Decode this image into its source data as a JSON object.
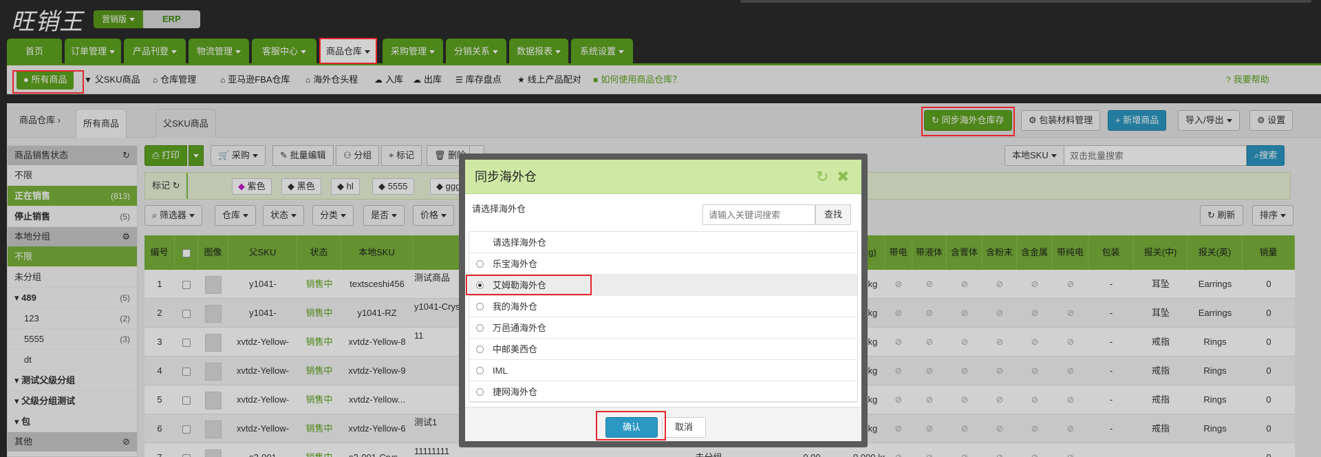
{
  "brand": {
    "logo": "旺销王",
    "edition": "营销版",
    "product": "ERP"
  },
  "main_nav": [
    {
      "label": "首页",
      "dropdown": false
    },
    {
      "label": "订单管理",
      "dropdown": true
    },
    {
      "label": "产品刊登",
      "dropdown": true
    },
    {
      "label": "物流管理",
      "dropdown": true
    },
    {
      "label": "客服中心",
      "dropdown": true
    },
    {
      "label": "商品仓库",
      "dropdown": true,
      "active": true
    },
    {
      "label": "采购管理",
      "dropdown": true
    },
    {
      "label": "分销关系",
      "dropdown": true
    },
    {
      "label": "数据报表",
      "dropdown": true
    },
    {
      "label": "系统设置",
      "dropdown": true
    }
  ],
  "sub_nav": {
    "all_products": "所有商品",
    "items": [
      "父SKU商品",
      "仓库管理",
      "亚马逊FBA仓库",
      "海外仓头程",
      "入库",
      "出库",
      "库存盘点",
      "线上产品配对"
    ],
    "how_to": "如何使用商品仓库？",
    "help": "我要帮助"
  },
  "breadcrumb": {
    "root": "商品仓库",
    "sep": "›",
    "tabs": [
      "所有商品",
      "父SKU商品"
    ]
  },
  "header_buttons": {
    "sync": "同步海外仓库存",
    "packaging": "包装材料管理",
    "add": "新增商品",
    "import_export": "导入/导出",
    "settings": "设置"
  },
  "toolbar": {
    "print": "打印",
    "purchase": "采购",
    "batch_edit": "批量编辑",
    "group": "分组",
    "mark": "标记",
    "delete": "删除"
  },
  "search": {
    "scope": "本地SKU",
    "placeholder": "双击批量搜索",
    "button": "搜索"
  },
  "mark_bar": {
    "label": "标记",
    "tags": [
      "紫色",
      "黑色",
      "hl",
      "5555",
      "ggg"
    ]
  },
  "filters": {
    "filter": "筛选器",
    "warehouse": "仓库",
    "status": "状态",
    "category": "分类",
    "yes_no": "是否",
    "price": "价格",
    "refresh": "刷新",
    "sort": "排序"
  },
  "sidebar": {
    "sales_status_title": "商品销售状态",
    "sales_status": [
      {
        "label": "不限",
        "count": ""
      },
      {
        "label": "正在销售",
        "count": "(813)",
        "active": true
      },
      {
        "label": "停止销售",
        "count": "(5)"
      }
    ],
    "groups_title": "本地分组",
    "groups": [
      {
        "label": "不限",
        "count": "",
        "active": true
      },
      {
        "label": "未分组",
        "count": ""
      },
      {
        "label": "▾ 489",
        "count": "(5)",
        "bold": true
      },
      {
        "label": "123",
        "count": "(2)",
        "indent": true
      },
      {
        "label": "5555",
        "count": "(3)",
        "indent": true
      },
      {
        "label": "dt",
        "count": "",
        "indent": true
      },
      {
        "label": "▾ 测试父级分组",
        "count": "",
        "bold": true
      },
      {
        "label": "▾ 父级分组测试",
        "count": "",
        "bold": true
      },
      {
        "label": "▾ 包",
        "count": "",
        "bold": true
      }
    ],
    "other_title": "其他"
  },
  "table": {
    "headers_left": [
      "编号",
      "",
      "图像",
      "父SKU",
      "状态",
      "本地SKU"
    ],
    "headers_right": [
      "(kg)",
      "带电",
      "带液体",
      "含膏体",
      "含粉末",
      "含金属",
      "带纯电",
      "包装",
      "报关(中)",
      "报关(英)",
      "销量"
    ],
    "rows": [
      {
        "no": "1",
        "parent": "y1041-",
        "status": "销售中",
        "sku": "textsceshi456",
        "name": "测试商品",
        "weight": "0 kg",
        "pack": "-",
        "cn": "耳坠",
        "en": "Earrings",
        "sales": "0"
      },
      {
        "no": "2",
        "parent": "y1041-",
        "status": "销售中",
        "sku": "y1041-RZ",
        "name": "y1041-Crys",
        "weight": "0 kg",
        "pack": "-",
        "cn": "耳坠",
        "en": "Earrings",
        "sales": "0"
      },
      {
        "no": "3",
        "parent": "xvtdz-Yellow-",
        "status": "销售中",
        "sku": "xvtdz-Yellow-8",
        "name": "11",
        "weight": "0 kg",
        "pack": "-",
        "cn": "戒指",
        "en": "Rings",
        "sales": "0"
      },
      {
        "no": "4",
        "parent": "xvtdz-Yellow-",
        "status": "销售中",
        "sku": "xvtdz-Yellow-9",
        "name": "",
        "weight": "0 kg",
        "pack": "-",
        "cn": "戒指",
        "en": "Rings",
        "sales": "0"
      },
      {
        "no": "5",
        "parent": "xvtdz-Yellow-",
        "status": "销售中",
        "sku": "xvtdz-Yellow...",
        "name": "",
        "weight": "0 kg",
        "pack": "-",
        "cn": "戒指",
        "en": "Rings",
        "sales": "0"
      },
      {
        "no": "6",
        "parent": "xvtdz-Yellow-",
        "status": "销售中",
        "sku": "xvtdz-Yellow-6",
        "name": "测试1",
        "weight": "0 kg",
        "pack": "-",
        "cn": "戒指",
        "en": "Rings",
        "sales": "0"
      },
      {
        "no": "7",
        "parent": "s2-001",
        "status": "销售中",
        "sku": "s2-001-Crys...",
        "name": "11111111",
        "weight": "0.000 kg",
        "pack": "-",
        "cn": "",
        "en": "",
        "sales": "0"
      }
    ],
    "row7_extra": {
      "group": "未分组",
      "price": "0.00"
    }
  },
  "modal": {
    "title": "同步海外仓",
    "label": "请选择海外仓",
    "search_placeholder": "请输入关键词搜索",
    "find": "查找",
    "options": [
      {
        "label": "请选择海外仓",
        "radio": false
      },
      {
        "label": "乐宝海外仓",
        "radio": true
      },
      {
        "label": "艾姆勒海外仓",
        "radio": true,
        "selected": true
      },
      {
        "label": "我的海外仓",
        "radio": true
      },
      {
        "label": "万邑通海外仓",
        "radio": true
      },
      {
        "label": "中邮美西仓",
        "radio": true
      },
      {
        "label": "IML",
        "radio": true
      },
      {
        "label": "捷网海外仓",
        "radio": true
      }
    ],
    "confirm": "确认",
    "cancel": "取消"
  },
  "colors": {
    "brand_green": "#5ea41f",
    "header_green": "#79b33a",
    "modal_head": "#cfe9a5",
    "primary_blue": "#2b98c3",
    "annotation_red": "#e3262b"
  }
}
